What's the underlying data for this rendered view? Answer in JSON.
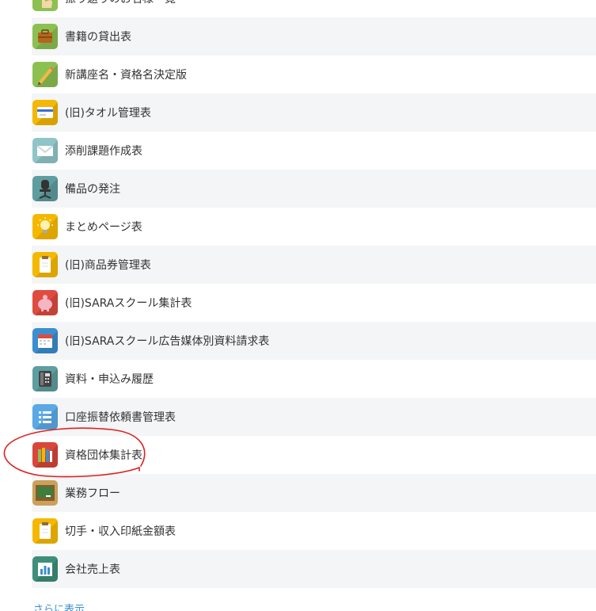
{
  "apps": [
    {
      "label": "振り返りのお名様一覧",
      "icon": "hand-icon",
      "color": "#8cc152",
      "shaded": false
    },
    {
      "label": "書籍の貸出表",
      "icon": "briefcase-icon",
      "color": "#8cc152",
      "shaded": true
    },
    {
      "label": "新講座名・資格名決定版",
      "icon": "pencil-icon",
      "color": "#8cc152",
      "shaded": false
    },
    {
      "label": "(旧)タオル管理表",
      "icon": "credit-card-icon",
      "color": "#f5b800",
      "shaded": true
    },
    {
      "label": "添削課題作成表",
      "icon": "envelope-icon",
      "color": "#8fc4c8",
      "shaded": false
    },
    {
      "label": "備品の発注",
      "icon": "office-chair-icon",
      "color": "#5f9ea0",
      "shaded": true
    },
    {
      "label": "まとめページ表",
      "icon": "lightbulb-icon",
      "color": "#f5b800",
      "shaded": false
    },
    {
      "label": "(旧)商品券管理表",
      "icon": "clipboard-icon",
      "color": "#f5b800",
      "shaded": true
    },
    {
      "label": "(旧)SARAスクール集計表",
      "icon": "piggy-bank-icon",
      "color": "#e04b3f",
      "shaded": false
    },
    {
      "label": "(旧)SARAスクール広告媒体別資料請求表",
      "icon": "calendar-icon",
      "color": "#3b8fd0",
      "shaded": true
    },
    {
      "label": "資料・申込み履歴",
      "icon": "phone-icon",
      "color": "#5f9ea0",
      "shaded": false
    },
    {
      "label": "口座振替依頼書管理表",
      "icon": "list-icon",
      "color": "#5aa9e6",
      "shaded": true
    },
    {
      "label": "資格団体集計表",
      "icon": "books-icon",
      "color": "#d9463a",
      "shaded": false
    },
    {
      "label": "業務フロー",
      "icon": "chalkboard-icon",
      "color": "#c9a15b",
      "shaded": true
    },
    {
      "label": "切手・収入印紙金額表",
      "icon": "clipboard-icon",
      "color": "#f5b800",
      "shaded": false
    },
    {
      "label": "会社売上表",
      "icon": "bar-chart-icon",
      "color": "#3d8f7a",
      "shaded": true
    }
  ],
  "more_link": "さらに表示",
  "annotation_color": "#e02020"
}
